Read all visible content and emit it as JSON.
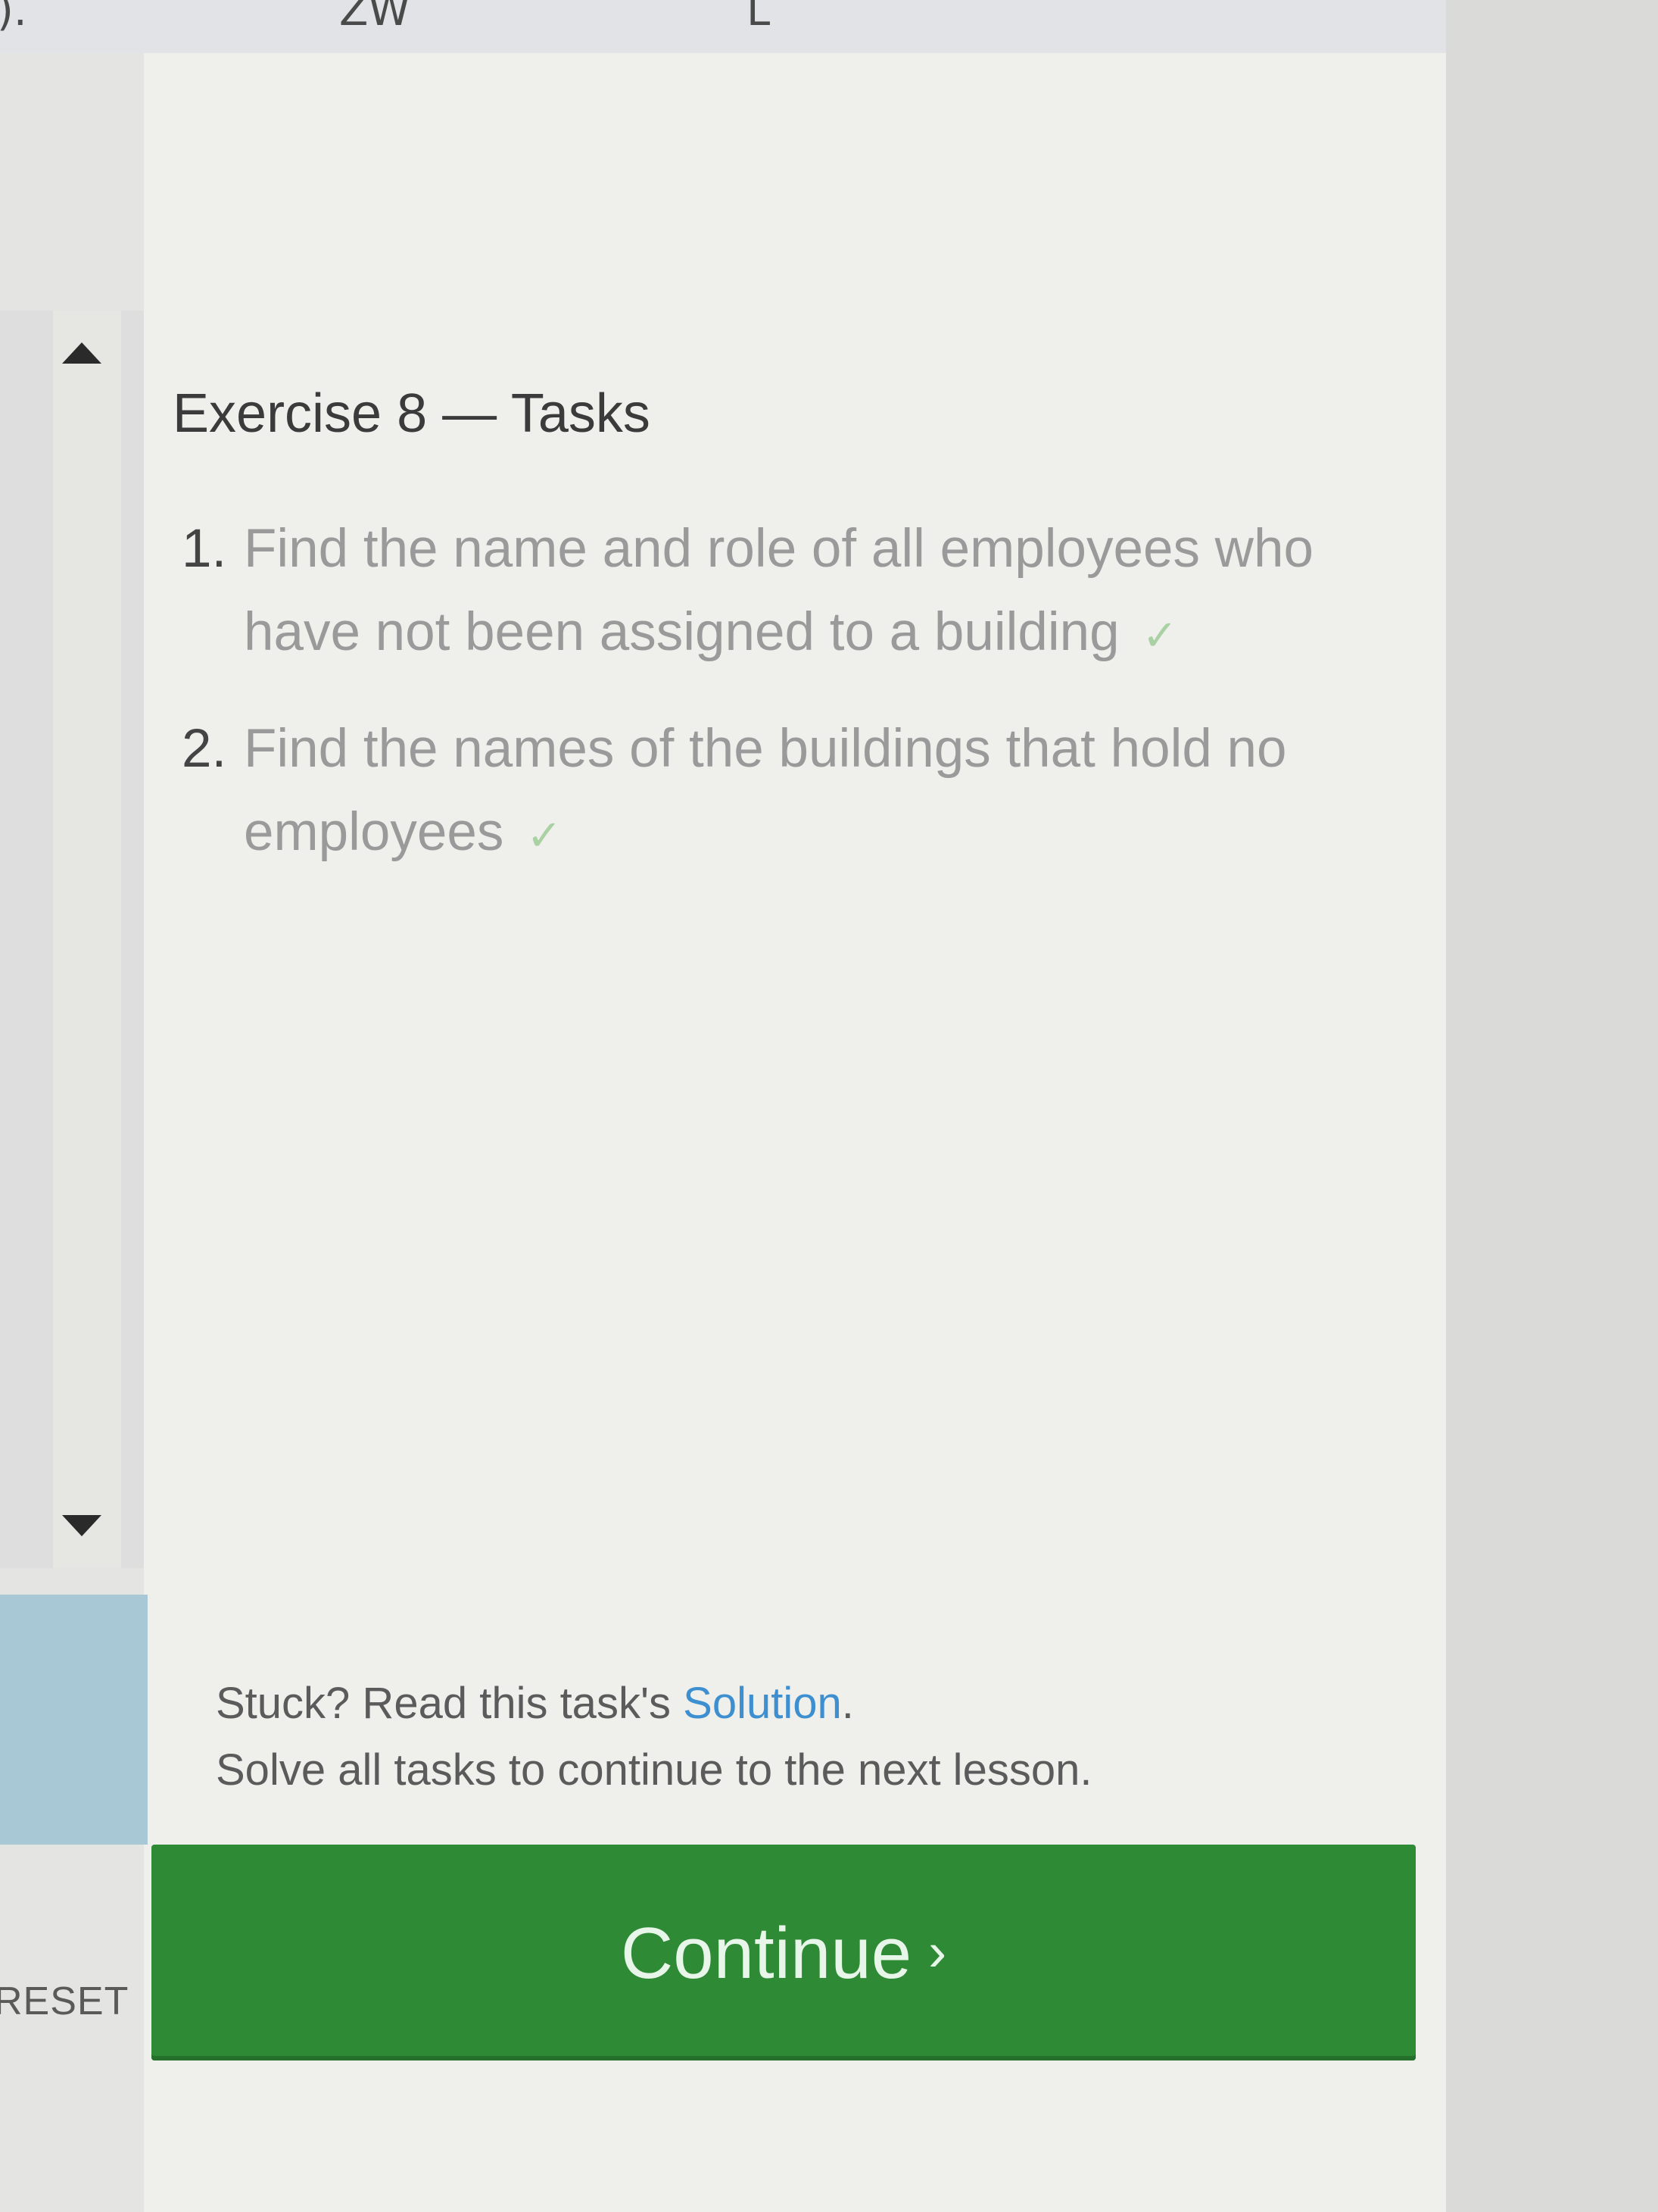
{
  "header_fragments": [
    ").",
    "ZW",
    "L"
  ],
  "exercise": {
    "title": "Exercise 8 — Tasks"
  },
  "tasks": [
    {
      "number": "1.",
      "text": "Find the name and role of all employees who have not been assigned to a building",
      "status": "✓"
    },
    {
      "number": "2.",
      "text": "Find the names of the buildings that hold no employees",
      "status": "✓"
    }
  ],
  "footer": {
    "stuck_prefix": "Stuck? Read this task's",
    "solution_link": "Solution",
    "stuck_suffix": ".",
    "instruction": "Solve all tasks to continue to the next lesson."
  },
  "buttons": {
    "continue_label": "Continue",
    "continue_chevron": "›",
    "reset_label": "RESET"
  },
  "colors": {
    "continue_button": "#2f8a35",
    "link": "#3d8fd0",
    "check": "#a9d1a4",
    "sidebar_accent": "#a9c8d6"
  }
}
